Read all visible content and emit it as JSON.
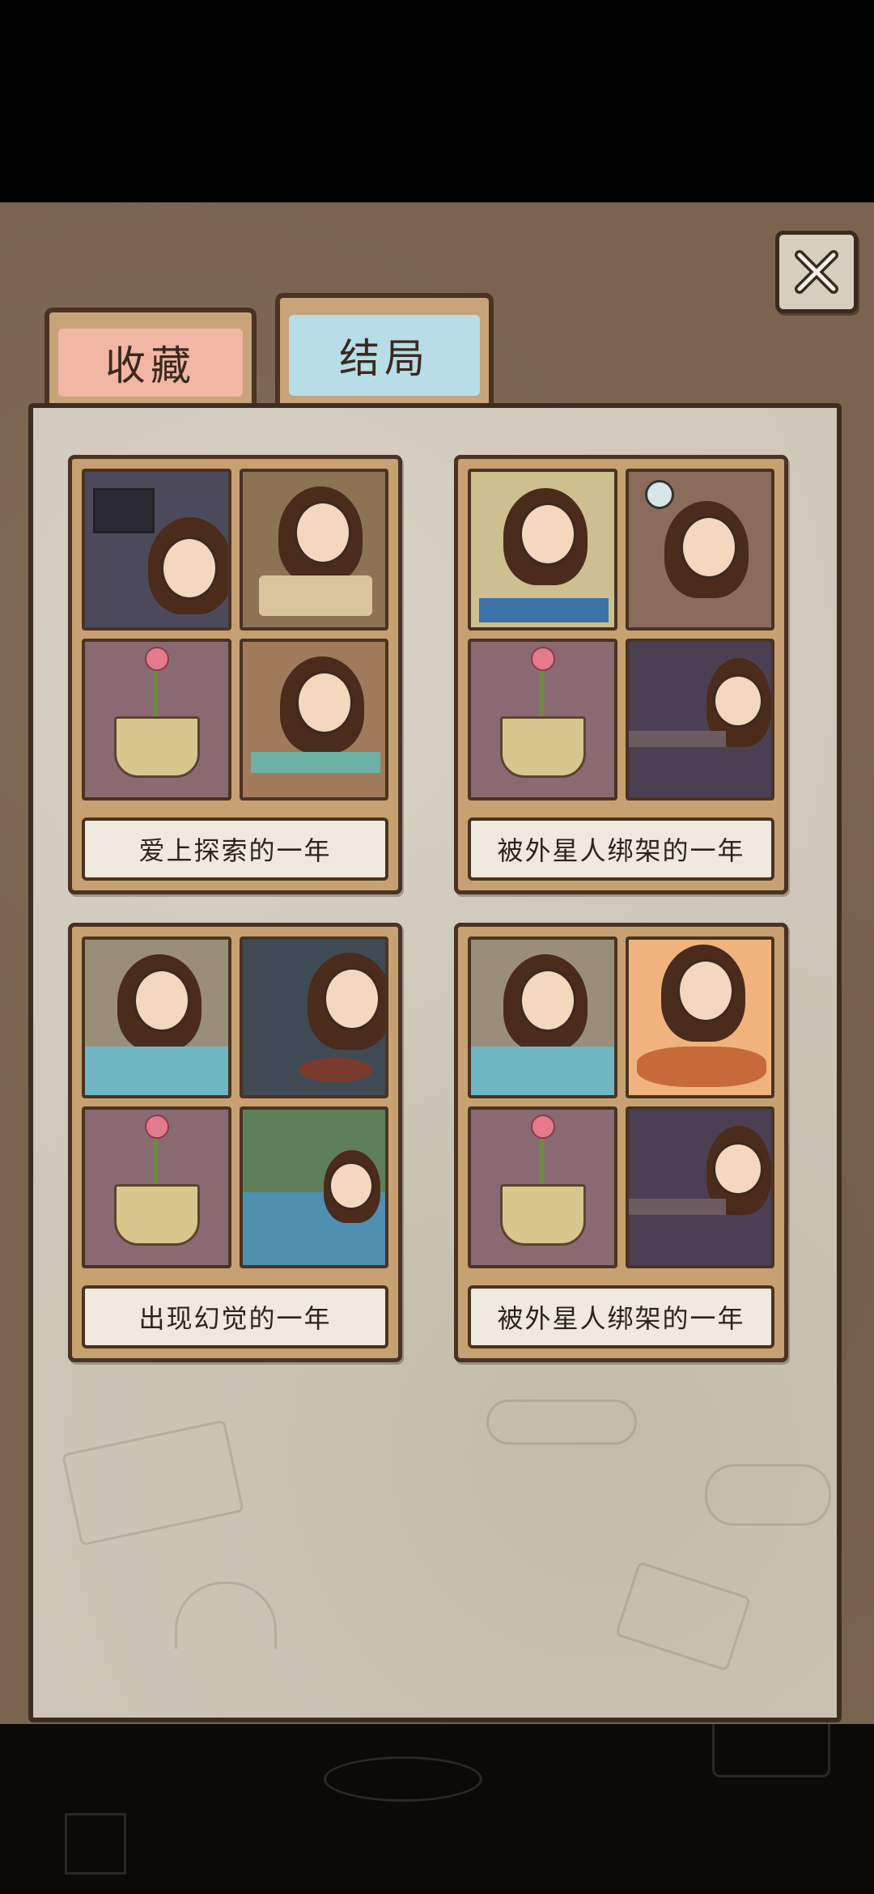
{
  "tabs": {
    "collection_label": "收藏",
    "ending_label": "结局"
  },
  "close_button": {
    "icon": "close-x-icon"
  },
  "endings": [
    {
      "caption": "爱上探索的一年",
      "tiles": [
        "girl-at-computer",
        "girl-meditating",
        "flower-pot",
        "girl-with-plants"
      ]
    },
    {
      "caption": "被外星人绑架的一年",
      "tiles": [
        "girl-yoga",
        "girl-confused",
        "flower-pot",
        "girl-at-bar"
      ]
    },
    {
      "caption": "出现幻觉的一年",
      "tiles": [
        "girl-eating",
        "girl-gaming",
        "flower-pot",
        "girl-fishing"
      ]
    },
    {
      "caption": "被外星人绑架的一年",
      "tiles": [
        "girl-eating",
        "girl-feast",
        "flower-pot",
        "girl-at-bar"
      ]
    }
  ],
  "colors": {
    "board": "#7a6450",
    "panel": "#cfc7b9",
    "tab_collection": "#f2b6a4",
    "tab_ending": "#b7dde6",
    "card_frame": "#c8a172"
  }
}
